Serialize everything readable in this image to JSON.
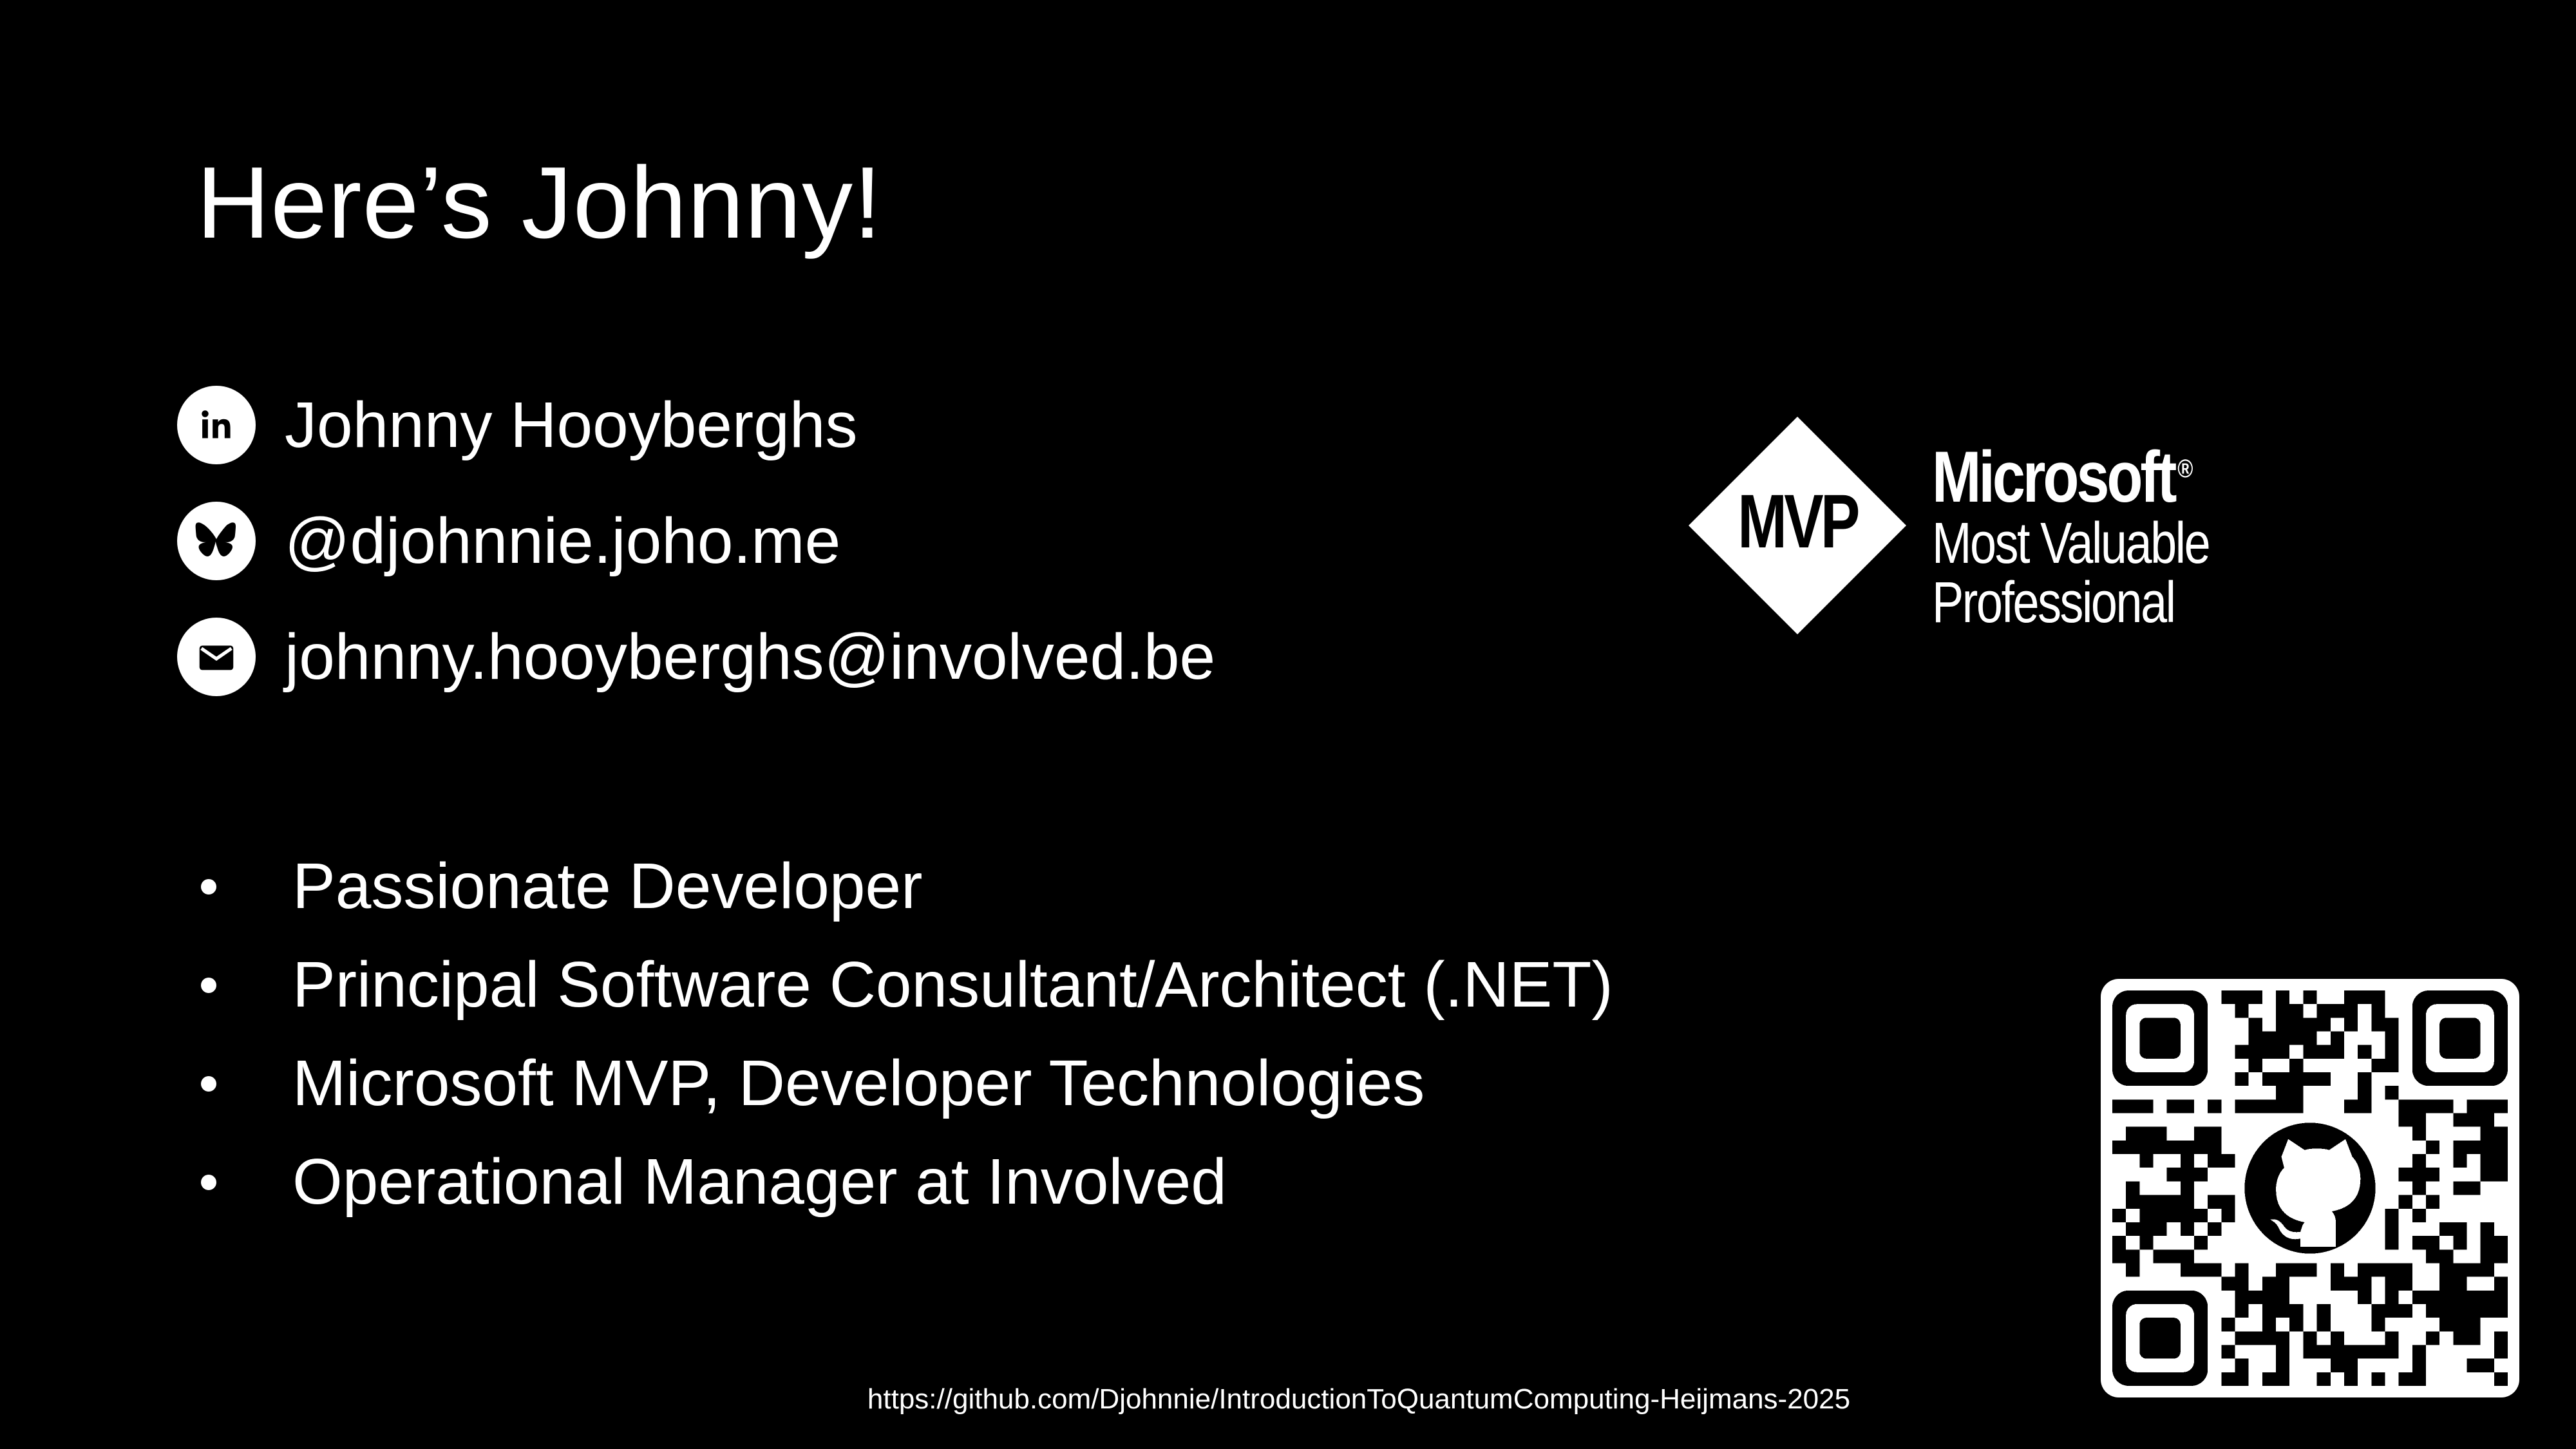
{
  "slide": {
    "title": "Here’s Johnny!",
    "contacts": [
      {
        "icon": "linkedin-icon",
        "text": "Johnny Hooyberghs"
      },
      {
        "icon": "bluesky-icon",
        "text": "@djohnnie.joho.me"
      },
      {
        "icon": "email-icon",
        "text": "johnny.hooyberghs@involved.be"
      }
    ],
    "bullets": [
      "Passionate Developer",
      "Principal Software Consultant/Architect (.NET)",
      "Microsoft MVP, Developer Technologies",
      "Operational Manager at Involved"
    ],
    "mvp_badge": {
      "diamond_text": "MVP",
      "line1": "Microsoft",
      "registered": "®",
      "line2": "Most Valuable",
      "line3": "Professional"
    },
    "qr": {
      "center_icon": "github-icon"
    },
    "url": "https://github.com/Djohnnie/IntroductionToQuantumComputing-Heijmans-2025"
  },
  "colors": {
    "background": "#000000",
    "foreground": "#ffffff"
  }
}
